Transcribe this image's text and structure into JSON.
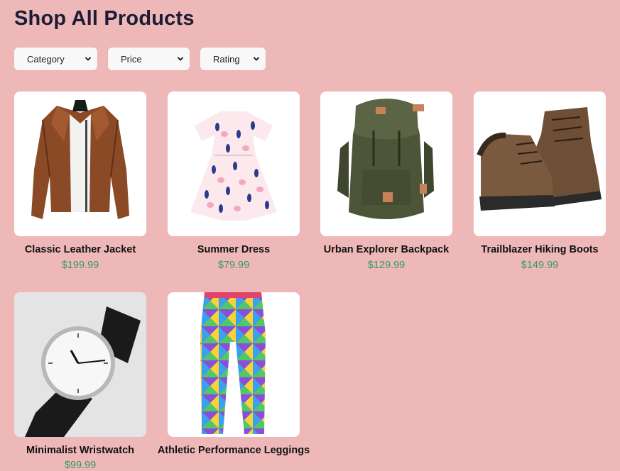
{
  "page": {
    "title": "Shop All Products"
  },
  "filters": [
    {
      "label": "Category"
    },
    {
      "label": "Price"
    },
    {
      "label": "Rating"
    }
  ],
  "products": [
    {
      "name": "Classic Leather Jacket",
      "price": "$199.99",
      "image_icon": "leather-jacket"
    },
    {
      "name": "Summer Dress",
      "price": "$79.99",
      "image_icon": "summer-dress"
    },
    {
      "name": "Urban Explorer Backpack",
      "price": "$129.99",
      "image_icon": "backpack"
    },
    {
      "name": "Trailblazer Hiking Boots",
      "price": "$149.99",
      "image_icon": "hiking-boots"
    },
    {
      "name": "Minimalist Wristwatch",
      "price": "$99.99",
      "image_icon": "wristwatch"
    },
    {
      "name": "Athletic Performance Leggings",
      "price": "",
      "image_icon": "leggings"
    }
  ],
  "colors": {
    "background": "#efb8b8",
    "price": "#2f9a5f",
    "title": "#1c1c34"
  }
}
